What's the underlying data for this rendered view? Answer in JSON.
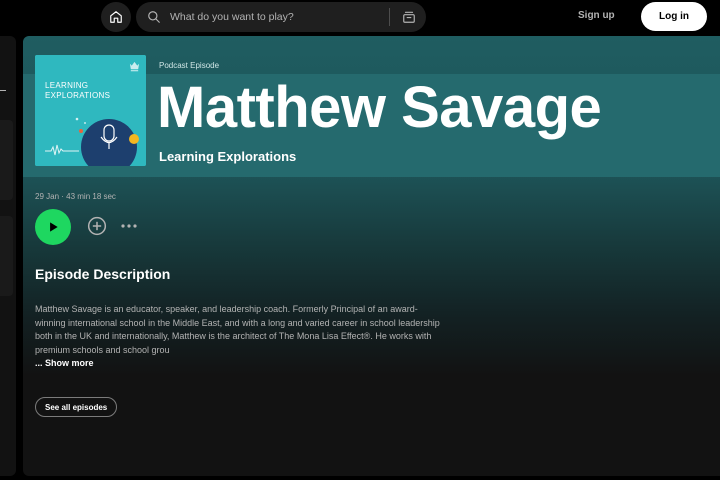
{
  "topbar": {
    "search_placeholder": "What do you want to play?",
    "signup_label": "Sign up",
    "login_label": "Log in",
    "icons": [
      "home-icon",
      "search-icon",
      "browse-icon"
    ]
  },
  "episode": {
    "type_label": "Podcast Episode",
    "title": "Matthew Savage",
    "show_name": "Learning Explorations",
    "cover_title_line1": "LEARNING",
    "cover_title_line2": "EXPLORATIONS",
    "meta": "29 Jan · 43 min 18 sec"
  },
  "actions": {
    "icons": [
      "play-icon",
      "add-icon",
      "more-icon"
    ]
  },
  "description": {
    "heading": "Episode Description",
    "text": "Matthew Savage is an educator, speaker, and leadership coach. Formerly Principal of an award-winning international school in the Middle East, and with a long and varied career in school leadership both in the UK and internationally, Matthew is the architect of The Mona Lisa Effect®. He works with premium schools and school grou",
    "show_more_label": "... Show more",
    "see_all_label": "See all episodes"
  },
  "colors": {
    "accent_green": "#1ed760",
    "header_teal": "#256a6e",
    "cover_teal": "#2fb8bf",
    "background": "#121212"
  }
}
